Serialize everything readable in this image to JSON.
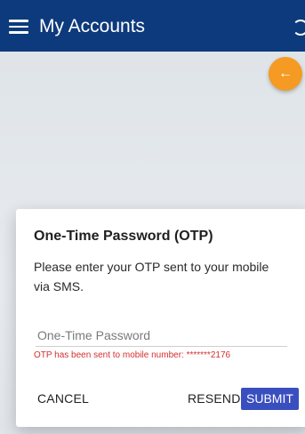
{
  "appbar": {
    "title": "My Accounts",
    "color": "#0d3a7c"
  },
  "icons": {
    "menu": "hamburger-menu-icon",
    "loading": "loading-spinner-icon",
    "back": "arrow-left-icon"
  },
  "fab": {
    "glyph": "←",
    "color": "#f59a23"
  },
  "dialog": {
    "title": "One-Time Password (OTP)",
    "message": "Please enter your OTP sent to your mobile via SMS.",
    "input": {
      "placeholder": "One-Time Password",
      "value": ""
    },
    "hint": "OTP has been sent to mobile number: *******2176",
    "hint_color": "#d32f2f",
    "buttons": {
      "cancel": "CANCEL",
      "resend": "RESEND",
      "submit": "SUBMIT"
    },
    "submit_color": "#3a4fbf"
  }
}
